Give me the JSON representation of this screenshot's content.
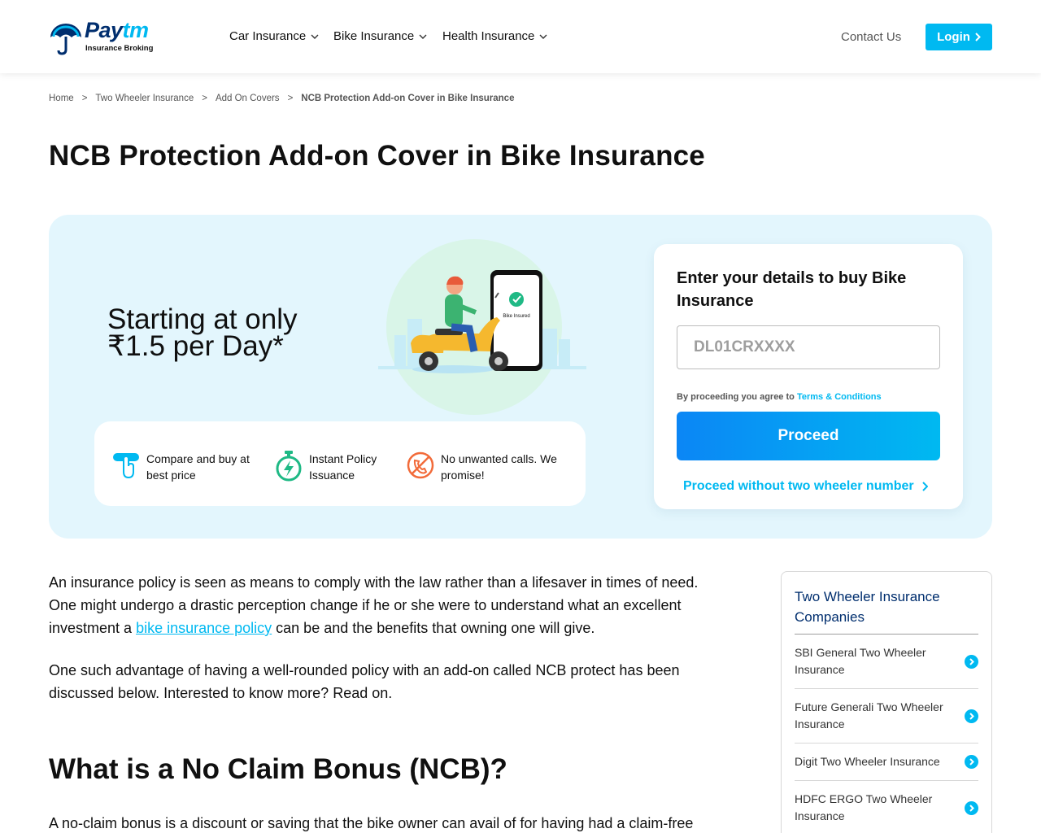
{
  "header": {
    "logo": {
      "word_main": "Pay",
      "word_accent": "tm",
      "subtitle": "Insurance Broking"
    },
    "nav": [
      {
        "label": "Car Insurance"
      },
      {
        "label": "Bike Insurance"
      },
      {
        "label": "Health Insurance"
      }
    ],
    "contact_label": "Contact Us",
    "login_label": "Login"
  },
  "breadcrumb": {
    "items": [
      "Home",
      "Two Wheeler Insurance",
      "Add On Covers"
    ],
    "separator": ">",
    "current": "NCB Protection Add-on Cover in Bike Insurance"
  },
  "page_title": "NCB Protection Add-on Cover in Bike Insurance",
  "hero": {
    "price_line1": "Starting at only",
    "price_line2": "₹1.5 per Day*",
    "illustration_badge": "Bike Insured",
    "features": [
      {
        "line1": "Compare and buy at",
        "line2": "best price",
        "icon": "hand-tap-icon"
      },
      {
        "line1": "Instant Policy",
        "line2": "Issuance",
        "icon": "stopwatch-bolt-icon"
      },
      {
        "line1": "No unwanted calls. We",
        "line2": "promise!",
        "icon": "no-call-icon"
      }
    ],
    "form": {
      "title": "Enter your details to buy Bike Insurance",
      "input_placeholder": "DL01CRXXXX",
      "input_value": "",
      "terms_prefix": "By proceeding you agree to",
      "terms_link": "Terms & Conditions",
      "proceed_label": "Proceed",
      "alt_label": "Proceed without two wheeler number"
    }
  },
  "article": {
    "para1_a": "An insurance policy is seen as means to comply with the law rather than a lifesaver in times of need. One might undergo a drastic perception change if he or she were to understand what an excellent investment a ",
    "para1_link": "bike insurance policy",
    "para1_b": " can be and the benefits that owning one will give.",
    "para2": "One such advantage of having a well-rounded policy with an add-on called NCB protect has been discussed below. Interested to know more? Read on.",
    "heading": "What is a No Claim Bonus (NCB)?",
    "para3": "A no-claim bonus is a discount or saving that the bike owner can avail of for having had a claim-free"
  },
  "sidebar": {
    "title": "Two Wheeler Insurance Companies",
    "items": [
      {
        "label": "SBI General Two Wheeler Insurance"
      },
      {
        "label": "Future Generali Two Wheeler Insurance"
      },
      {
        "label": "Digit Two Wheeler Insurance"
      },
      {
        "label": "HDFC ERGO Two Wheeler Insurance"
      }
    ]
  },
  "colors": {
    "brand_blue": "#00b9f1",
    "brand_navy": "#002e6e",
    "hero_bg": "#e3f6fd"
  }
}
